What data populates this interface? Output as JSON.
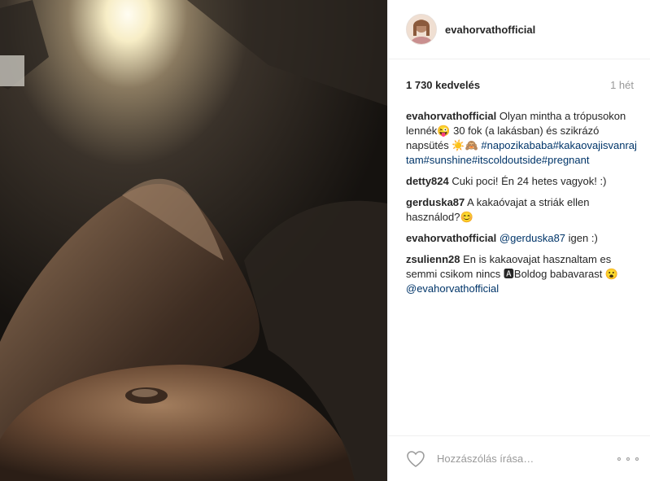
{
  "post": {
    "username": "evahorvathofficial",
    "likes": "1 730 kedvelés",
    "time": "1 hét"
  },
  "caption": {
    "user": "evahorvathofficial",
    "text": "Olyan mintha a trópusokon lennék😜 30 fok (a lakásban) és szikrázó napsütés ☀️🙈",
    "hashtags": "#napozikababa#kakaovajisvanrajtam#sunshine#itscoldoutside#pregnant"
  },
  "comments": [
    {
      "user": "detty824",
      "text": "Cuki poci! Én 24 hetes vagyok! :)"
    },
    {
      "user": "gerduska87",
      "text": "A kakaóvajat a striák ellen használod?😊"
    },
    {
      "user": "evahorvathofficial",
      "mention": "@gerduska87",
      "text": " igen :)"
    },
    {
      "user": "zsulienn28",
      "text": "En is kakaovajat hasznaltam es semmi csikom nincs 🅰Boldog babavarast 😮 ",
      "mention": "@evahorvathofficial"
    }
  ],
  "footer": {
    "comment_placeholder": "Hozzászólás írása…"
  },
  "colors": {
    "link": "#003569",
    "muted": "#999999"
  },
  "icons": [
    "heart-icon",
    "more-options-icon"
  ]
}
